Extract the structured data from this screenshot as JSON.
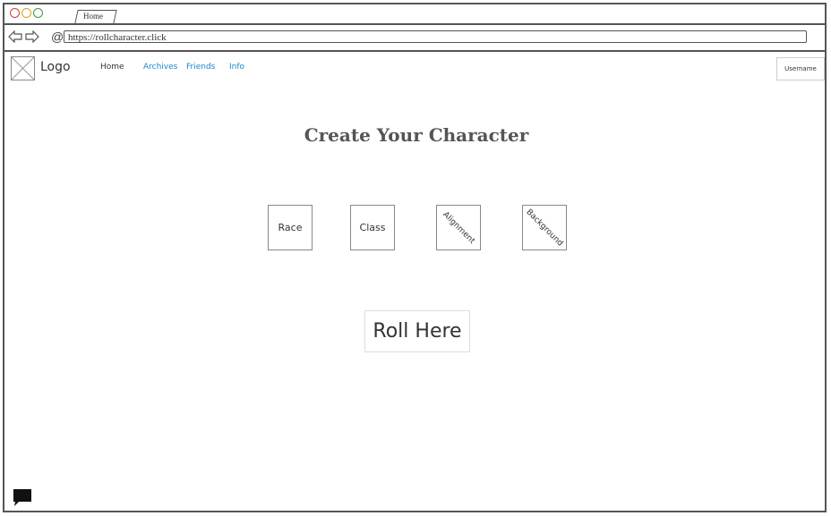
{
  "browser": {
    "tab_label": "Home",
    "url": "https://rollcharacter.click"
  },
  "header": {
    "logo_text": "Logo",
    "nav": {
      "home": "Home",
      "archives": "Archives",
      "friends": "Friends",
      "info": "Info"
    },
    "username": "Username"
  },
  "main": {
    "title": "Create Your Character",
    "choices": {
      "race": "Race",
      "class": "Class",
      "alignment": "Alignment",
      "background": "Background"
    },
    "roll_label": "Roll Here"
  },
  "colors": {
    "link": "#1a86c8",
    "frame": "#555555"
  }
}
